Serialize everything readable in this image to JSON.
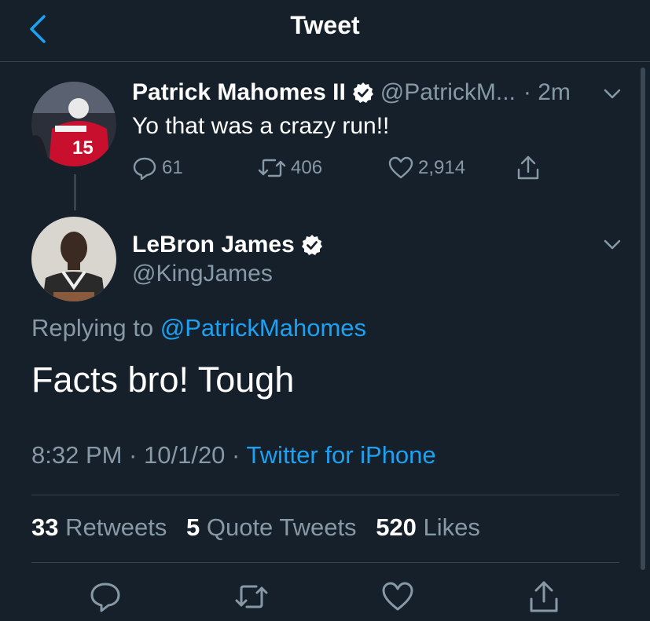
{
  "header": {
    "title": "Tweet"
  },
  "parent_tweet": {
    "name": "Patrick Mahomes II",
    "handle": "@PatrickM...",
    "time": "· 2m",
    "text": "Yo that was a crazy run!!",
    "replies": "61",
    "retweets": "406",
    "likes": "2,914"
  },
  "main_tweet": {
    "name": "LeBron James",
    "handle": "@KingJames",
    "replying_prefix": "Replying to",
    "replying_to": "@PatrickMahomes",
    "text": "Facts bro! Tough",
    "time": "8:32 PM · 10/1/20 ·",
    "source": "Twitter for iPhone"
  },
  "stats": {
    "retweets_count": "33",
    "retweets_label": "Retweets",
    "quotes_count": "5",
    "quotes_label": "Quote Tweets",
    "likes_count": "520",
    "likes_label": "Likes"
  },
  "colors": {
    "background": "#15202b",
    "accent": "#1da1f2",
    "muted": "#8899a6",
    "divider": "#38444d"
  }
}
